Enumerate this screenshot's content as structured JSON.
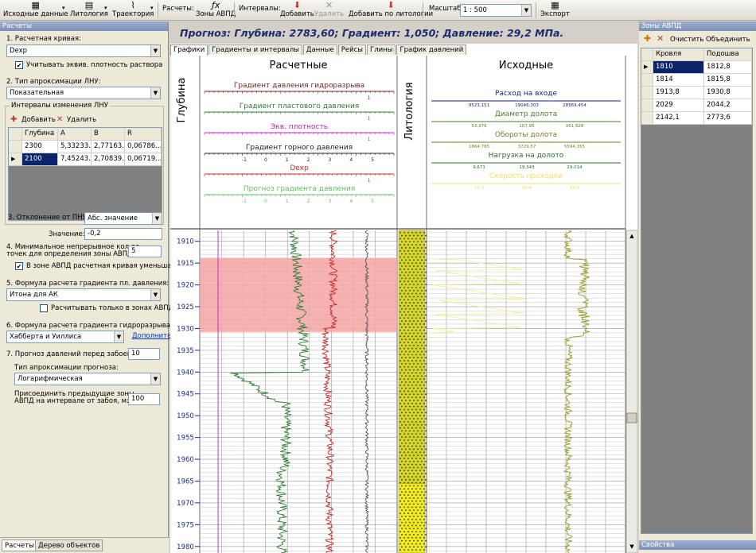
{
  "toolbar": {
    "input_data": "Исходные данные",
    "lithology": "Литология",
    "trajectory": "Траектория",
    "calcs_label": "Расчеты:",
    "avpd_zones": "Зоны АВПД",
    "intervals_label": "Интервалы:",
    "add": "Добавить",
    "delete": "Удалить",
    "add_by_lithology": "Добавить по литологии",
    "scale_label": "Масштаб:",
    "scale_value": "1 : 500",
    "export": "Экспорт"
  },
  "left": {
    "title": "Расчеты",
    "s1": "1. Расчетная кривая:",
    "curve": "Dexp",
    "chk_density": "Учитывать эквив. плотность раствора",
    "s2": "2. Тип апроксимации ЛНУ:",
    "approx": "Показательная",
    "group": "Интервалы изменения ЛНУ",
    "add": "Добавить",
    "delete": "Удалить",
    "cols": [
      "Глубина",
      "A",
      "B",
      "R"
    ],
    "rows": [
      [
        "2300",
        "5,33233...",
        "2,77163...",
        "0,06786..."
      ],
      [
        "2100",
        "7,45243...",
        "2,70839...",
        "0,06719..."
      ]
    ],
    "s3": "3. Отклонение от ПНУ:",
    "dev_type": "Абс. значение",
    "value_label": "Значение:",
    "value": "-0,2",
    "s4_1": "4. Минимальное непрерывное кол-во",
    "s4_2": "точек для определения зоны АВПД:",
    "min_points": "5",
    "chk_avpd": "В зоне АВПД расчетная кривая уменьшается",
    "s5": "5. Формула расчета градиента пл. давления:",
    "formula5": "Итона для АК",
    "chk_only": "Расчитывать только в зонах АВПД",
    "s6": "6. Формула расчета градиента гидроразрыва:",
    "formula6": "Хабберта и Уиллиса",
    "more": "Дополнительно",
    "s7": "7. Прогноз давлений перед забоем, м:",
    "forecast_m": "10",
    "s7_type": "Тип апроксимации прогноза:",
    "forecast_type": "Логарифмическая",
    "join_1": "Присоединить предыдущие зоны",
    "join_2": "АВПД на интервале от забоя, м:",
    "join_m": "100",
    "tabs": [
      "Расчеты",
      "Дерево объектов"
    ]
  },
  "main": {
    "forecast": "Прогноз:   Глубина: 2783,60;  Градиент: 1,050;  Давление: 29,2 МПа.",
    "tabs": [
      "Графики",
      "Градиенты и интервалы",
      "Данные",
      "Рейсы",
      "Глины",
      "График давлений"
    ],
    "depth_header": "Глубина",
    "calc_header": "Расчетные",
    "lith_header": "Литология",
    "source_header": "Исходные",
    "calc_curves": [
      {
        "name": "Градиент давления гидроразрыва",
        "color": "#7a1f1f",
        "ticks": [
          "",
          "",
          "",
          "",
          "",
          "1"
        ]
      },
      {
        "name": "Градиент пластового давления",
        "color": "#2e7d32",
        "ticks": [
          "",
          "",
          "",
          "",
          "",
          "1"
        ]
      },
      {
        "name": "Экв. плотность",
        "color": "#c020c0",
        "ticks": [
          "",
          "",
          "",
          "",
          "",
          "1"
        ]
      },
      {
        "name": "Градиент горного давления",
        "color": "#222222",
        "ticks": [
          "-1",
          "0",
          "1",
          "2",
          "3",
          "4",
          "5"
        ]
      },
      {
        "name": "Dexp",
        "color": "#c62828",
        "ticks": [
          "",
          "",
          "",
          "",
          "",
          "1"
        ]
      },
      {
        "name": "Прогноз градиента давления",
        "color": "#66bb6a",
        "ticks": [
          "-1",
          "0",
          "1",
          "2",
          "3",
          "4",
          "5"
        ]
      }
    ],
    "source_curves": [
      {
        "name": "Расход на входе",
        "color": "#1a237e",
        "ticks": [
          "9523,151",
          "19046,303",
          "28569,454"
        ]
      },
      {
        "name": "Диаметр долота",
        "color": "#4e7d2a",
        "ticks": [
          "53,976",
          "107,95",
          "161,926"
        ]
      },
      {
        "name": "Обороты долота",
        "color": "#7a7a2a",
        "ticks": [
          "1864,785",
          "3729,57",
          "5594,355"
        ]
      },
      {
        "name": "Нагрузка на долото",
        "color": "#2e6b2e",
        "ticks": [
          "9,671",
          "19,343",
          "29,014"
        ]
      },
      {
        "name": "Скорость проходки",
        "color": "#e8e070",
        "ticks": [
          "15,2",
          "30,4",
          "45,6"
        ]
      }
    ],
    "depths": [
      "1910",
      "1915",
      "1920",
      "1925",
      "1930",
      "1935",
      "1940",
      "1945",
      "1950",
      "1955",
      "1960",
      "1965",
      "1970",
      "1975",
      "1980"
    ]
  },
  "zones": {
    "title": "Зоны АВПД",
    "clear": "Очистить",
    "merge": "Объединить",
    "cols": [
      "Кровля",
      "Подошва"
    ],
    "rows": [
      [
        "1810",
        "1812,8"
      ],
      [
        "1814",
        "1815,8"
      ],
      [
        "1913,8",
        "1930,8"
      ],
      [
        "2029",
        "2044,2"
      ],
      [
        "2142,1",
        "2773,6"
      ]
    ],
    "props": "Свойства"
  }
}
